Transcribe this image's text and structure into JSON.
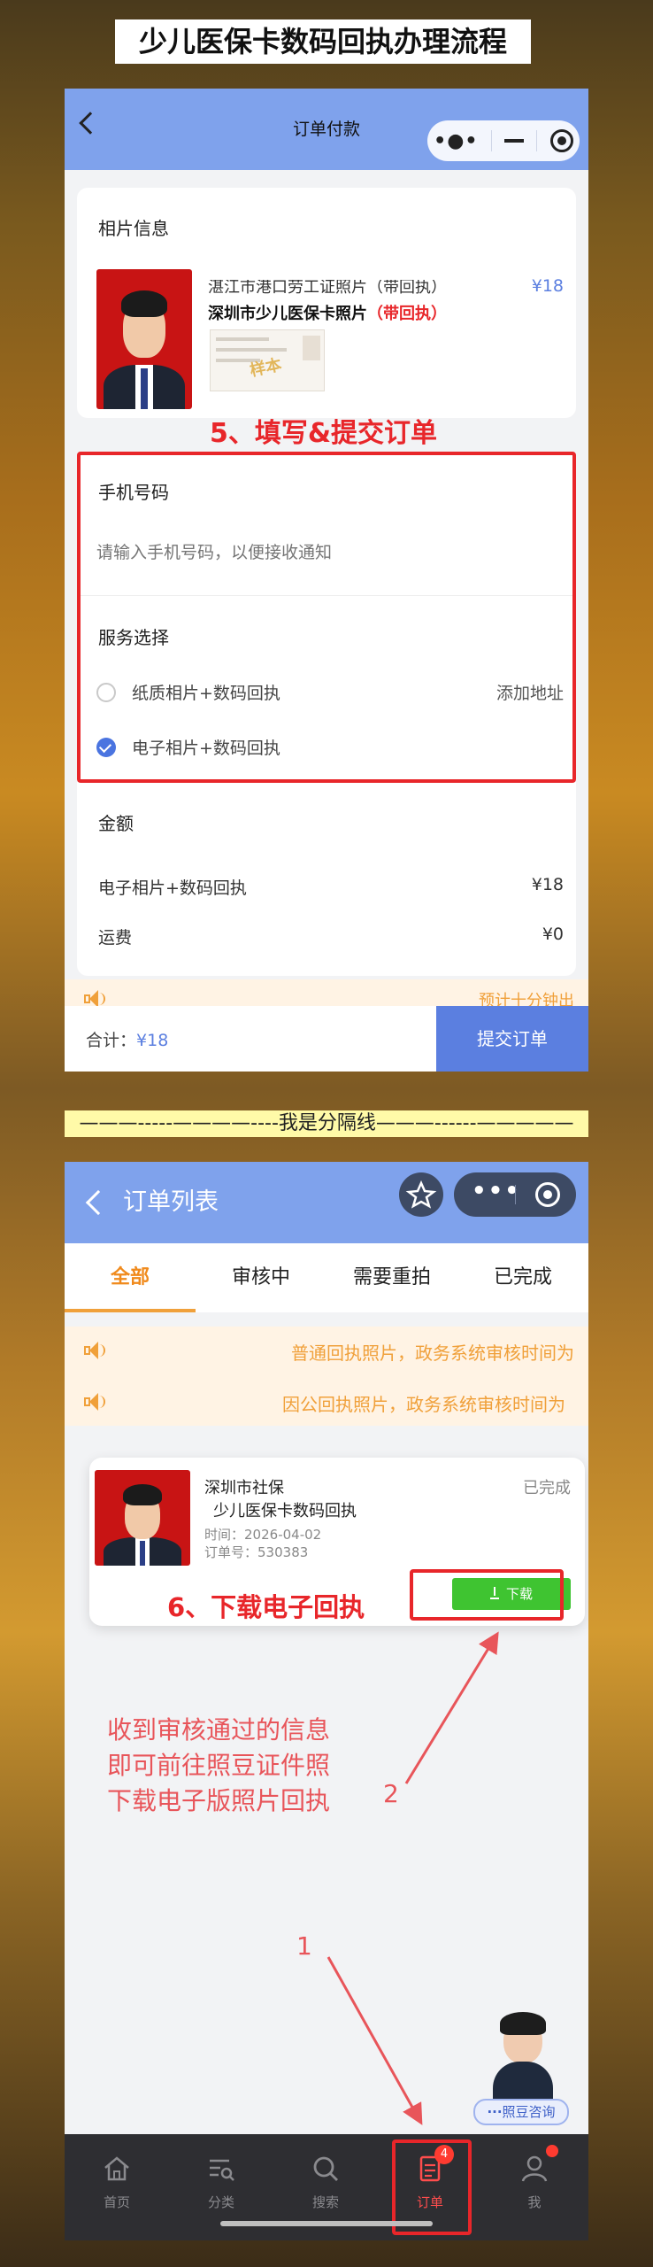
{
  "banner_title": "少儿医保卡数码回执办理流程",
  "screen1": {
    "nav_title": "订单付款",
    "photo_section": {
      "title": "相片信息",
      "item_name_faded": "湛江市港口劳工证照片（带回执）",
      "item_name": "深圳市少儿医保卡照片",
      "item_tag": "（带回执）",
      "price": "¥18",
      "sample_stamp": "样本"
    },
    "step5_label": "5、填写&提交订单",
    "phone": {
      "title": "手机号码",
      "placeholder": "请输入手机号码，以便接收通知"
    },
    "service": {
      "title": "服务选择",
      "options": [
        {
          "label": "纸质相片+数码回执",
          "selected": false,
          "extra": "添加地址"
        },
        {
          "label": "电子相片+数码回执",
          "selected": true,
          "extra": ""
        }
      ]
    },
    "amount": {
      "title": "金额",
      "rows": [
        {
          "label": "电子相片+数码回执",
          "value": "¥18"
        },
        {
          "label": "运费",
          "value": "¥0"
        }
      ]
    },
    "notice_text": "预计十分钟出",
    "total_label": "合计：",
    "total_value": "¥18",
    "submit_label": "提交订单"
  },
  "divider_text": "———-----————----我是分隔线———------—————",
  "screen2": {
    "nav_title": "订单列表",
    "tabs": [
      "全部",
      "审核中",
      "需要重拍",
      "已完成"
    ],
    "active_tab": 0,
    "notices": [
      "普通回执照片，政务系统审核时间为",
      "因公回执照片，政务系统审核时间为"
    ],
    "order": {
      "org": "深圳市社保",
      "status": "已完成",
      "product": "少儿医保卡数码回执",
      "time_label": "时间：",
      "time": "2026-04-02",
      "order_no_label": "订单号：",
      "order_no": "530383",
      "download_label": "下载"
    },
    "step6_label": "6、下载电子回执",
    "annotation_lines": [
      "收到审核通过的信息",
      "即可前往照豆证件照",
      "下载电子版照片回执"
    ],
    "arrow_label_2": "2",
    "arrow_label_1": "1",
    "consult_label": "照豆咨询",
    "tabbar": [
      {
        "label": "首页",
        "icon": "home-icon"
      },
      {
        "label": "分类",
        "icon": "category-search-icon"
      },
      {
        "label": "搜索",
        "icon": "search-icon"
      },
      {
        "label": "订单",
        "icon": "order-icon",
        "badge": "4"
      },
      {
        "label": "我",
        "icon": "person-icon"
      }
    ]
  },
  "colors": {
    "nav_blue": "#7fa2ec",
    "accent_red": "#e8262a",
    "orange": "#f0a03a",
    "green": "#3fc431",
    "submit_blue": "#5b7fe0"
  }
}
